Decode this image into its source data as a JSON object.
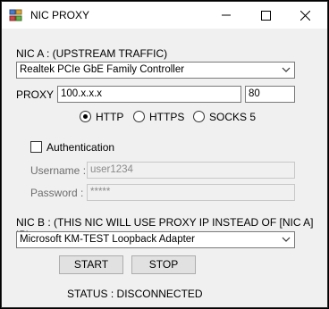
{
  "window": {
    "title": "NIC PROXY",
    "controls": {
      "minimize_icon": "minimize-icon",
      "maximize_icon": "maximize-icon",
      "close_icon": "close-icon"
    }
  },
  "nic_a": {
    "label": "NIC A : (UPSTREAM TRAFFIC)",
    "selected": "Realtek PCIe GbE Family Controller"
  },
  "proxy": {
    "label": "PROXY",
    "address": "100.x.x.x",
    "port": "80",
    "protocols": [
      {
        "label": "HTTP",
        "selected": true
      },
      {
        "label": "HTTPS",
        "selected": false
      },
      {
        "label": "SOCKS 5",
        "selected": false
      }
    ]
  },
  "auth": {
    "label": "Authentication",
    "checked": false,
    "username_label": "Username :",
    "username": "user1234",
    "password_label": "Password :",
    "password": "*****"
  },
  "nic_b": {
    "label": "NIC B : (THIS NIC WILL USE PROXY IP INSTEAD OF [NIC A] IP)",
    "selected": "Microsoft KM-TEST Loopback Adapter"
  },
  "buttons": {
    "start": "START",
    "stop": "STOP"
  },
  "status": "STATUS : DISCONNECTED"
}
